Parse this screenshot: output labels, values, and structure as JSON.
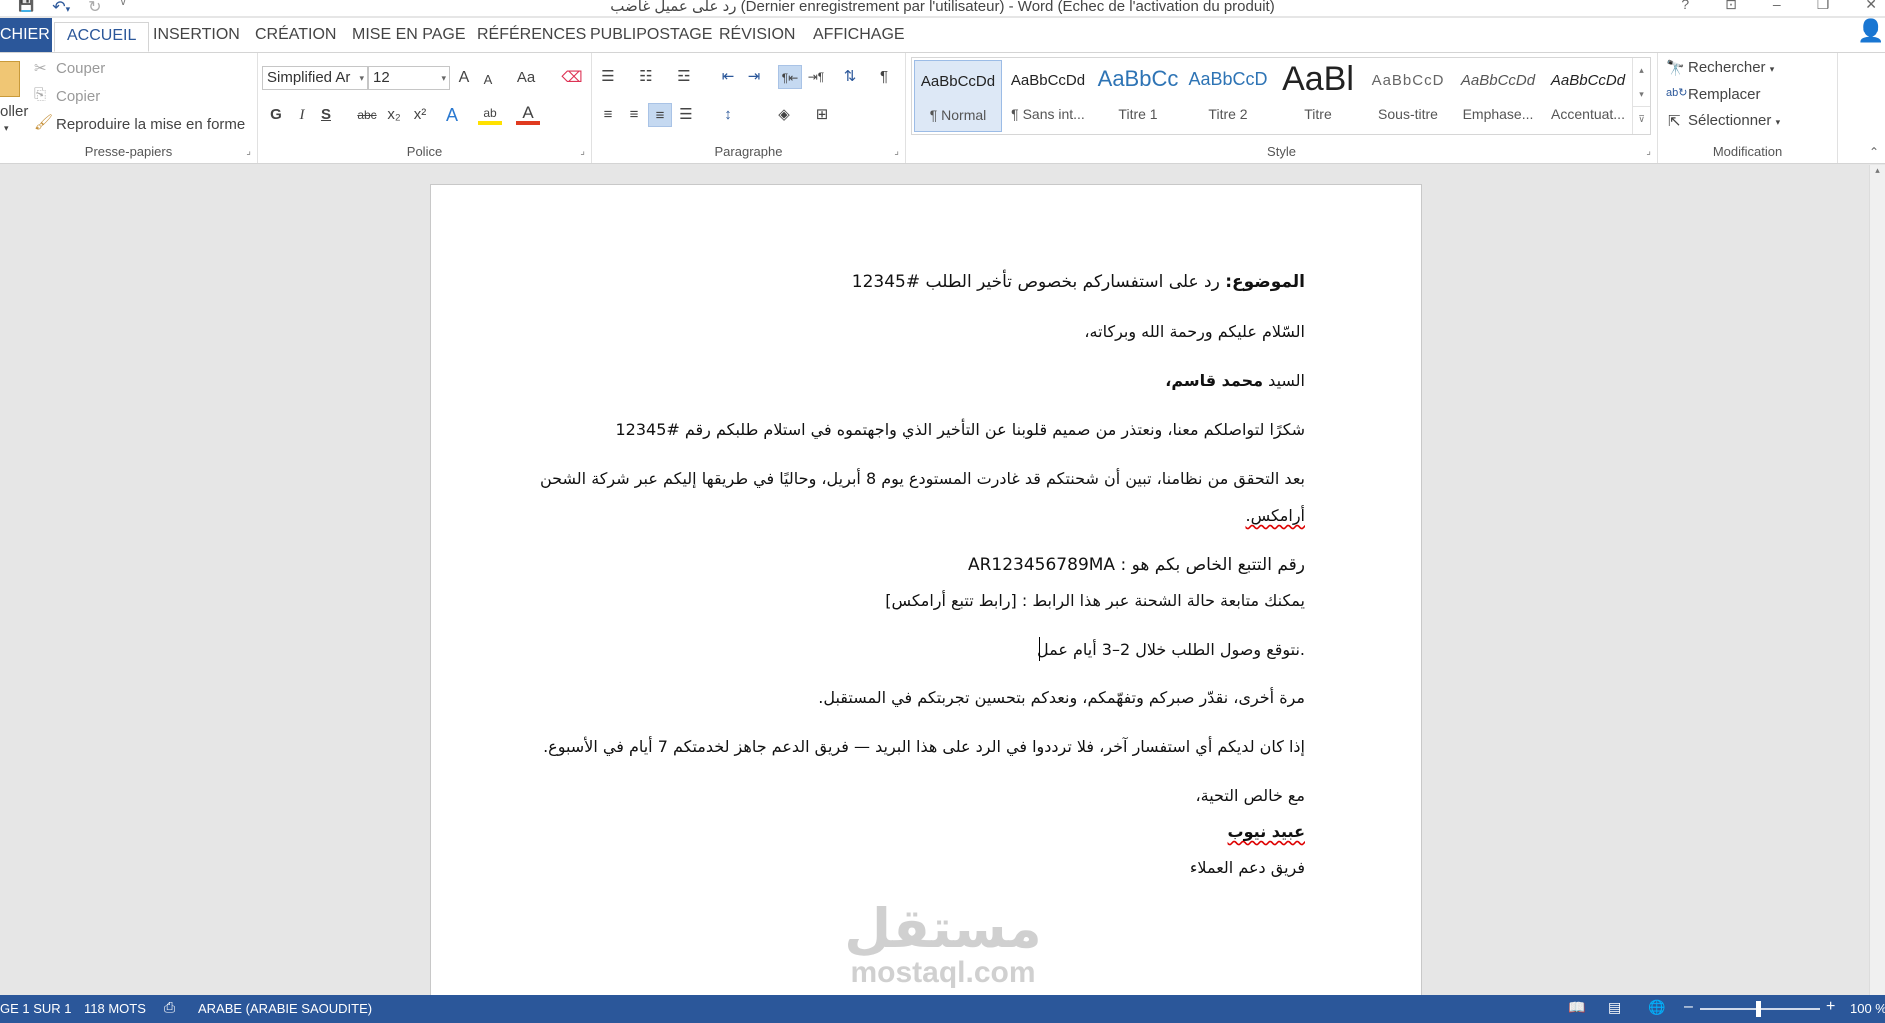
{
  "window": {
    "title": "رد على عميل غاضب (Dernier enregistrement par l'utilisateur) - Word (Echec de l'activation du produit)",
    "help": "?",
    "minimize": "–",
    "restore": "❐",
    "close": "✕"
  },
  "qat": {
    "save": "💾",
    "undo": "↶",
    "undo_drop": "▾",
    "redo": "↻",
    "customize": "⊽"
  },
  "tabs": [
    {
      "label": "CHIER"
    },
    {
      "label": "ACCUEIL"
    },
    {
      "label": "INSERTION"
    },
    {
      "label": "CRÉATION"
    },
    {
      "label": "MISE EN PAGE"
    },
    {
      "label": "RÉFÉRENCES"
    },
    {
      "label": "PUBLIPOSTAGE"
    },
    {
      "label": "RÉVISION"
    },
    {
      "label": "AFFICHAGE"
    }
  ],
  "ribbon": {
    "clipboard": {
      "label": "Presse-papiers",
      "paste": "oller",
      "cut": "Couper",
      "copy": "Copier",
      "format_painter": "Reproduire la mise en forme"
    },
    "font": {
      "label": "Police",
      "font_name": "Simplified Ar",
      "font_size": "12",
      "grow": "A",
      "shrink": "A",
      "case": "Aa",
      "bold": "G",
      "italic": "I",
      "underline": "S",
      "strike": "abc",
      "subscript": "x₂",
      "superscript": "x²",
      "effects": "A",
      "highlight": "ab",
      "font_color": "A"
    },
    "paragraph": {
      "label": "Paragraphe",
      "pilcrow": "¶"
    },
    "styles": {
      "label": "Style",
      "items": [
        {
          "sample": "AaBbCcDd",
          "name": "¶ Normal"
        },
        {
          "sample": "AaBbCcDd",
          "name": "¶ Sans int..."
        },
        {
          "sample": "AaBbCc",
          "name": "Titre 1"
        },
        {
          "sample": "AaBbCcD",
          "name": "Titre 2"
        },
        {
          "sample": "AaBl",
          "name": "Titre"
        },
        {
          "sample": "AaBbCcD",
          "name": "Sous-titre"
        },
        {
          "sample": "AaBbCcDd",
          "name": "Emphase..."
        },
        {
          "sample": "AaBbCcDd",
          "name": "Accentuat..."
        }
      ]
    },
    "editing": {
      "label": "Modification",
      "find": "Rechercher",
      "replace": "Remplacer",
      "select": "Sélectionner"
    }
  },
  "document": {
    "subject_label": "الموضوع:",
    "subject_text": " رد على استفساركم بخصوص تأخير الطلب #12345",
    "greeting": "السّلام عليكم ورحمة الله وبركاته،",
    "sir": "السيد ",
    "name": "محمد قاسم،",
    "p1": "شكرًا لتواصلكم معنا، ونعتذر من صميم قلوبنا عن التأخير الذي واجهتموه في استلام طلبكم رقم #12345",
    "p2": "بعد التحقق من نظامنا، تبين أن شحنتكم قد غادرت المستودع يوم 8 أبريل، وحاليًا في طريقها إليكم عبر شركة الشحن",
    "p2b": "أرامكس.",
    "tracking": "رقم التتبع الخاص بكم  هو  :  AR123456789MA",
    "link": "يمكنك متابعة حالة الشحنة عبر هذا الرابط : [رابط تتبع أرامكس]",
    "delivery": ".نتوقع وصول الطلب خلال 2–3 أيام عمل",
    "again": "مرة أخرى، نقدّر صبركم وتفهّمكم، ونعدكم بتحسين تجربتكم في المستقبل.",
    "further": "إذا كان لديكم أي استفسار آخر، فلا ترددوا في الرد على هذا البريد — فريق الدعم جاهز لخدمتكم 7 أيام في الأسبوع.",
    "closing": "مع خالص التحية،",
    "signer": "عبيد نيوب",
    "team": "فريق دعم العملاء"
  },
  "watermark": {
    "arabic": "مستقل",
    "latin": "mostaql.com"
  },
  "status": {
    "page": "GE 1 SUR 1",
    "words": "118 MOTS",
    "language": "ARABE (ARABIE SAOUDITE)",
    "zoom": "100 %",
    "zoom_minus": "–",
    "zoom_plus": "+"
  },
  "colors": {
    "accent": "#2b579a",
    "style_selected": "#dde8f6",
    "heading_blue": "#2e74b5"
  }
}
